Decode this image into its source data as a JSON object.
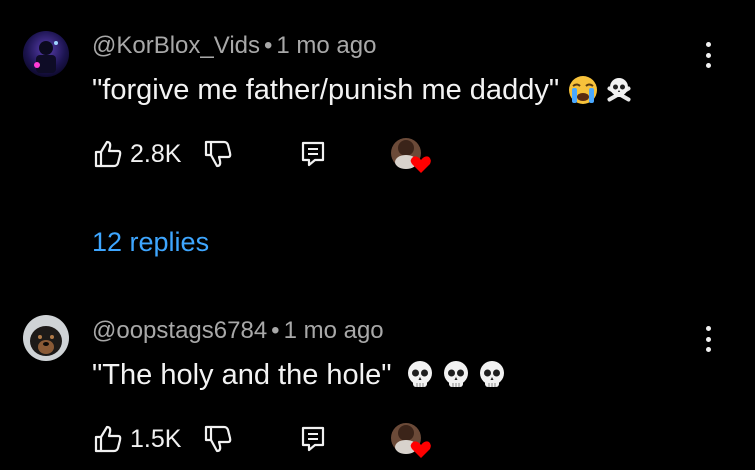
{
  "comments": [
    {
      "author": "@KorBlox_Vids",
      "separator": "•",
      "time": "1 mo ago",
      "text": "\"forgive me father/punish me daddy\"",
      "emojis": [
        "crying-face-emoji",
        "skull-and-crossbones-emoji"
      ],
      "likes": "2.8K",
      "replies_label": "12 replies"
    },
    {
      "author": "@oopstags6784",
      "separator": "•",
      "time": "1 mo ago",
      "text": "\"The holy and the hole\"",
      "emojis": [
        "skull-emoji",
        "skull-emoji",
        "skull-emoji"
      ],
      "likes": "1.5K"
    }
  ],
  "colors": {
    "background": "#000000",
    "meta_text": "#a8a8a8",
    "link": "#3ea6ff",
    "heart": "#ff0000"
  }
}
